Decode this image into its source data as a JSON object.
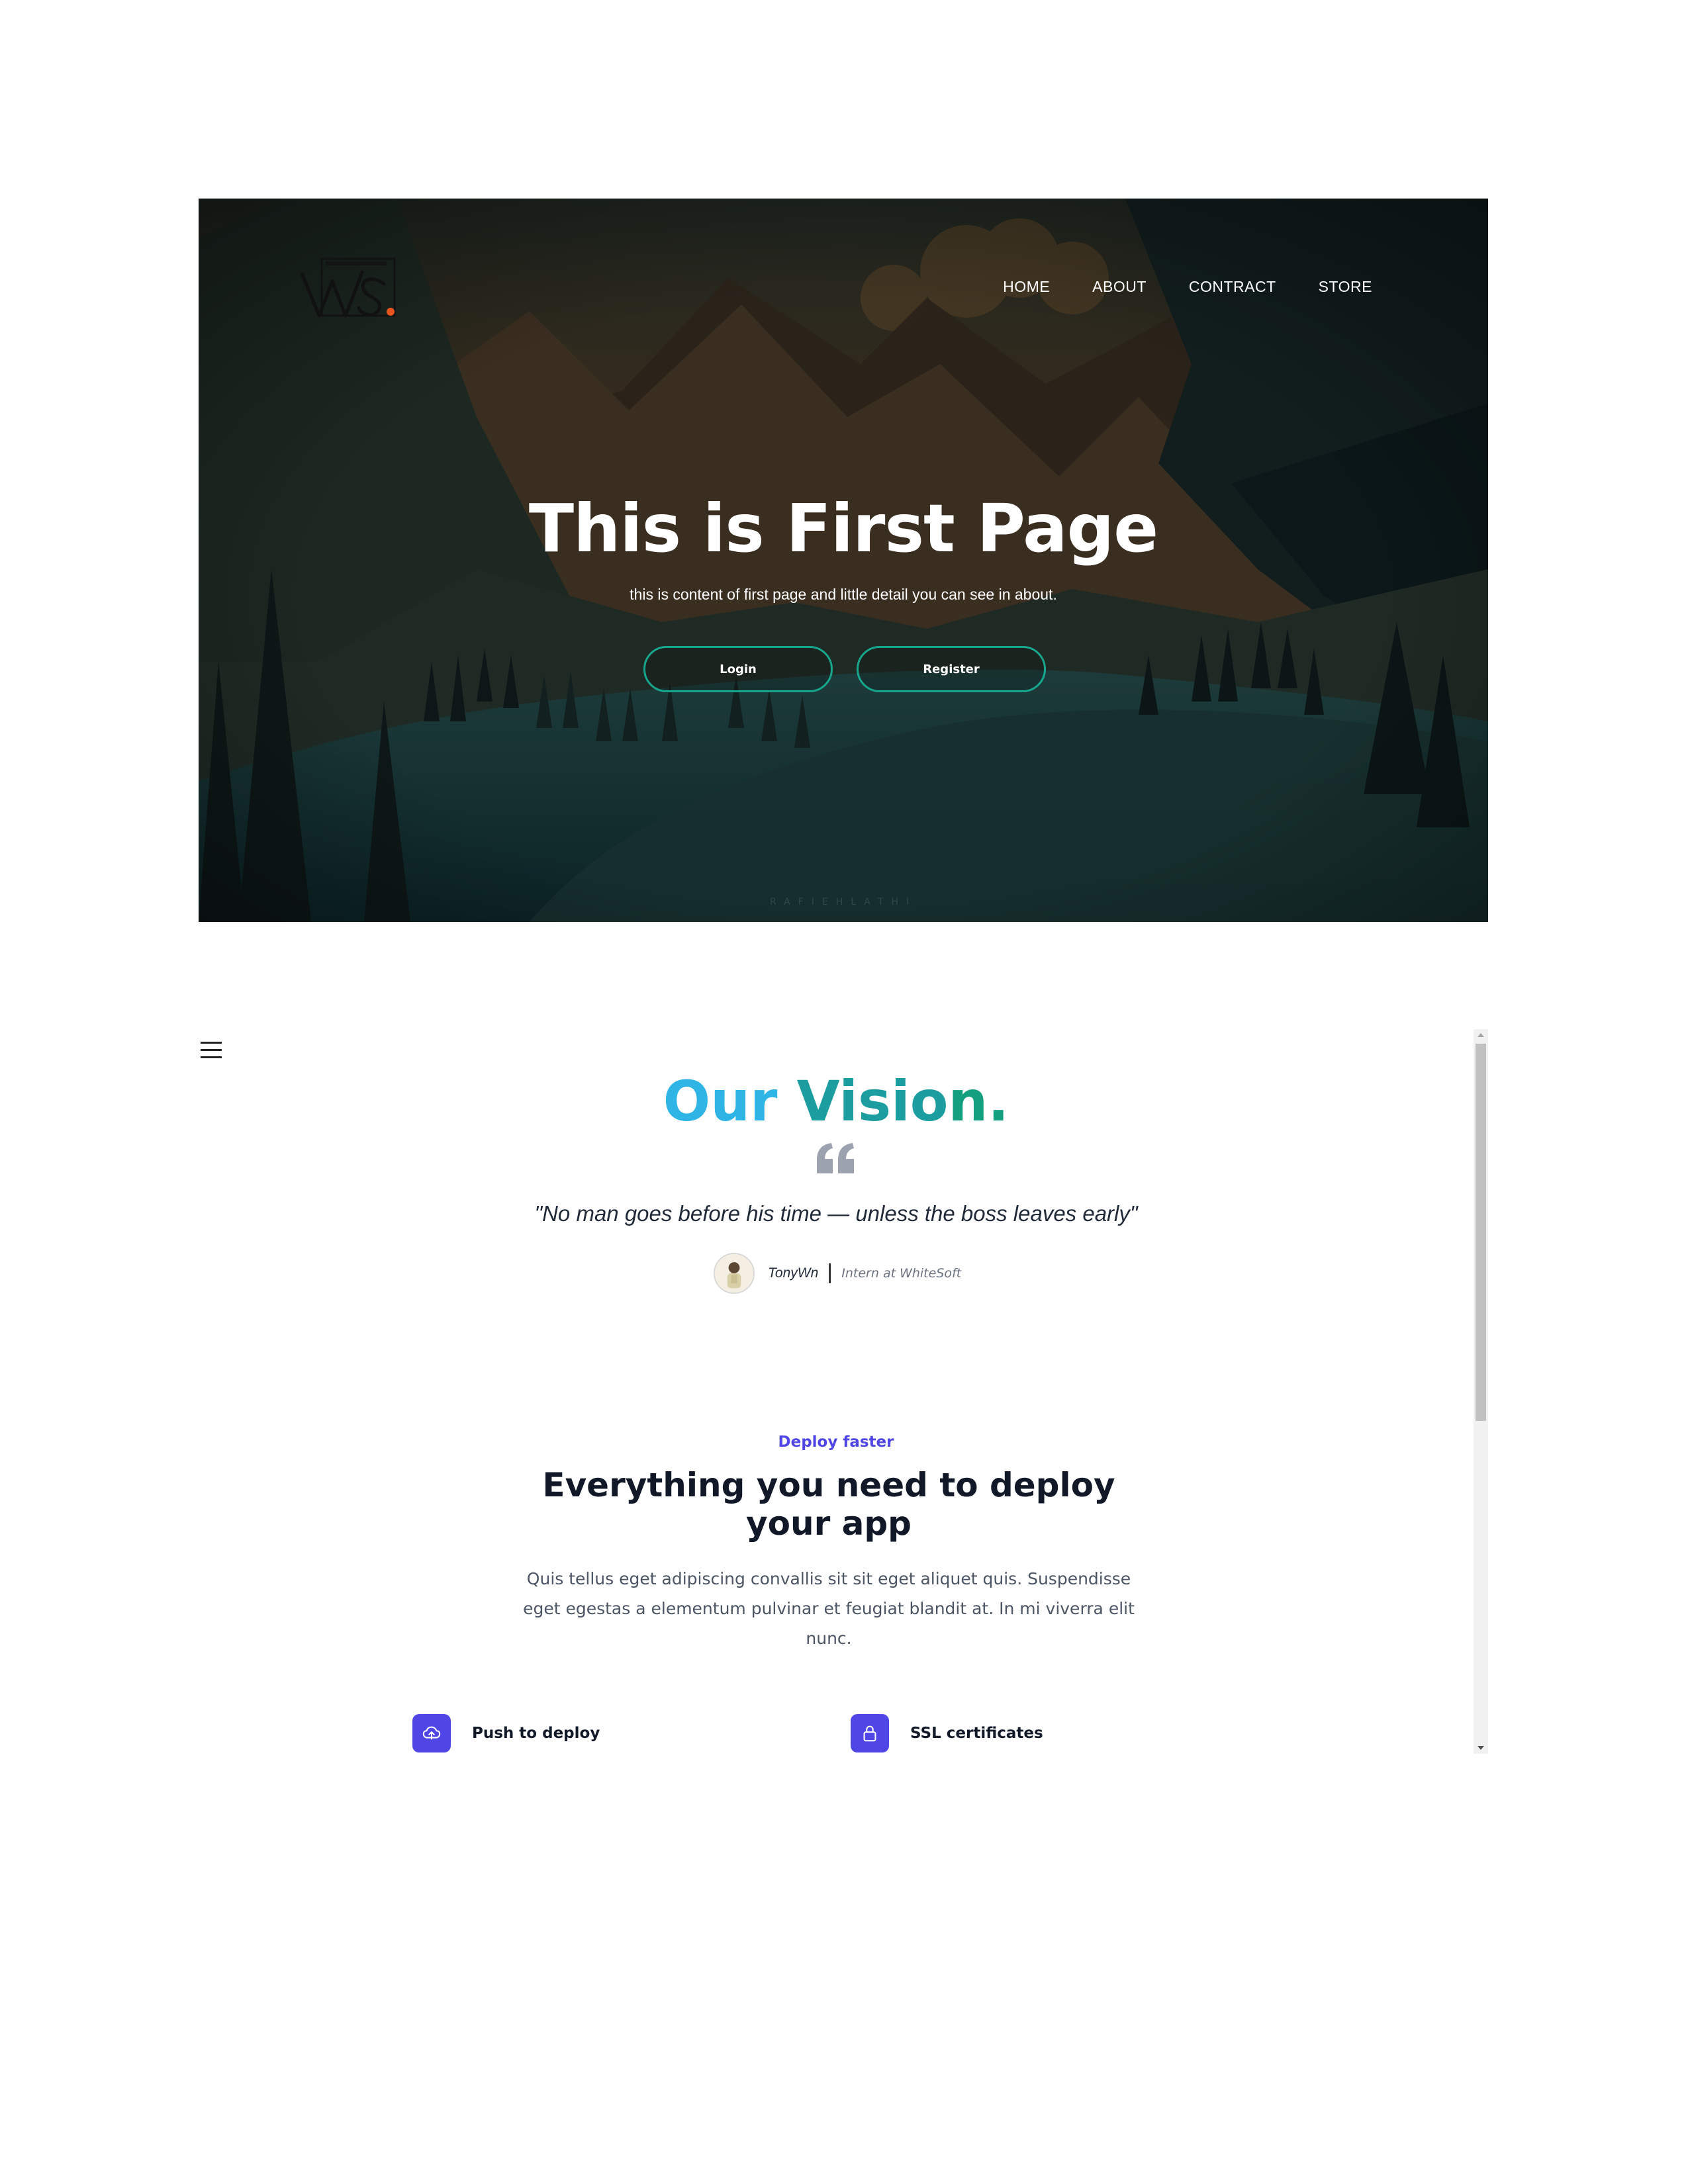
{
  "hero": {
    "logo_text": "WS.",
    "nav": [
      "HOME",
      "ABOUT",
      "CONTRACT",
      "STORE"
    ],
    "title": "This is First Page",
    "subtitle": "this is content of first page and little detail you can see in about.",
    "login_label": "Login",
    "register_label": "Register",
    "watermark": "RAFIEHLATHI"
  },
  "vision": {
    "title_part1": "Our",
    "title_part2": "Visio",
    "title_part3": "n.",
    "quote": "\"No man goes before his time — unless the boss leaves early\"",
    "author_name": "TonyWn",
    "author_role": "Intern at WhiteSoft"
  },
  "deploy": {
    "eyebrow": "Deploy faster",
    "title": "Everything you need to deploy your app",
    "description": "Quis tellus eget adipiscing convallis sit sit eget aliquet quis. Suspendisse eget egestas a elementum pulvinar et feugiat blandit at. In mi viverra elit nunc.",
    "features": [
      {
        "label": "Push to deploy",
        "icon": "cloud-upload-icon"
      },
      {
        "label": "SSL certificates",
        "icon": "lock-icon"
      }
    ]
  },
  "colors": {
    "accent": "#4f46e5",
    "button_border": "#17a68d",
    "vision_blue": "#2eb5e6",
    "vision_green": "#14a07f"
  }
}
